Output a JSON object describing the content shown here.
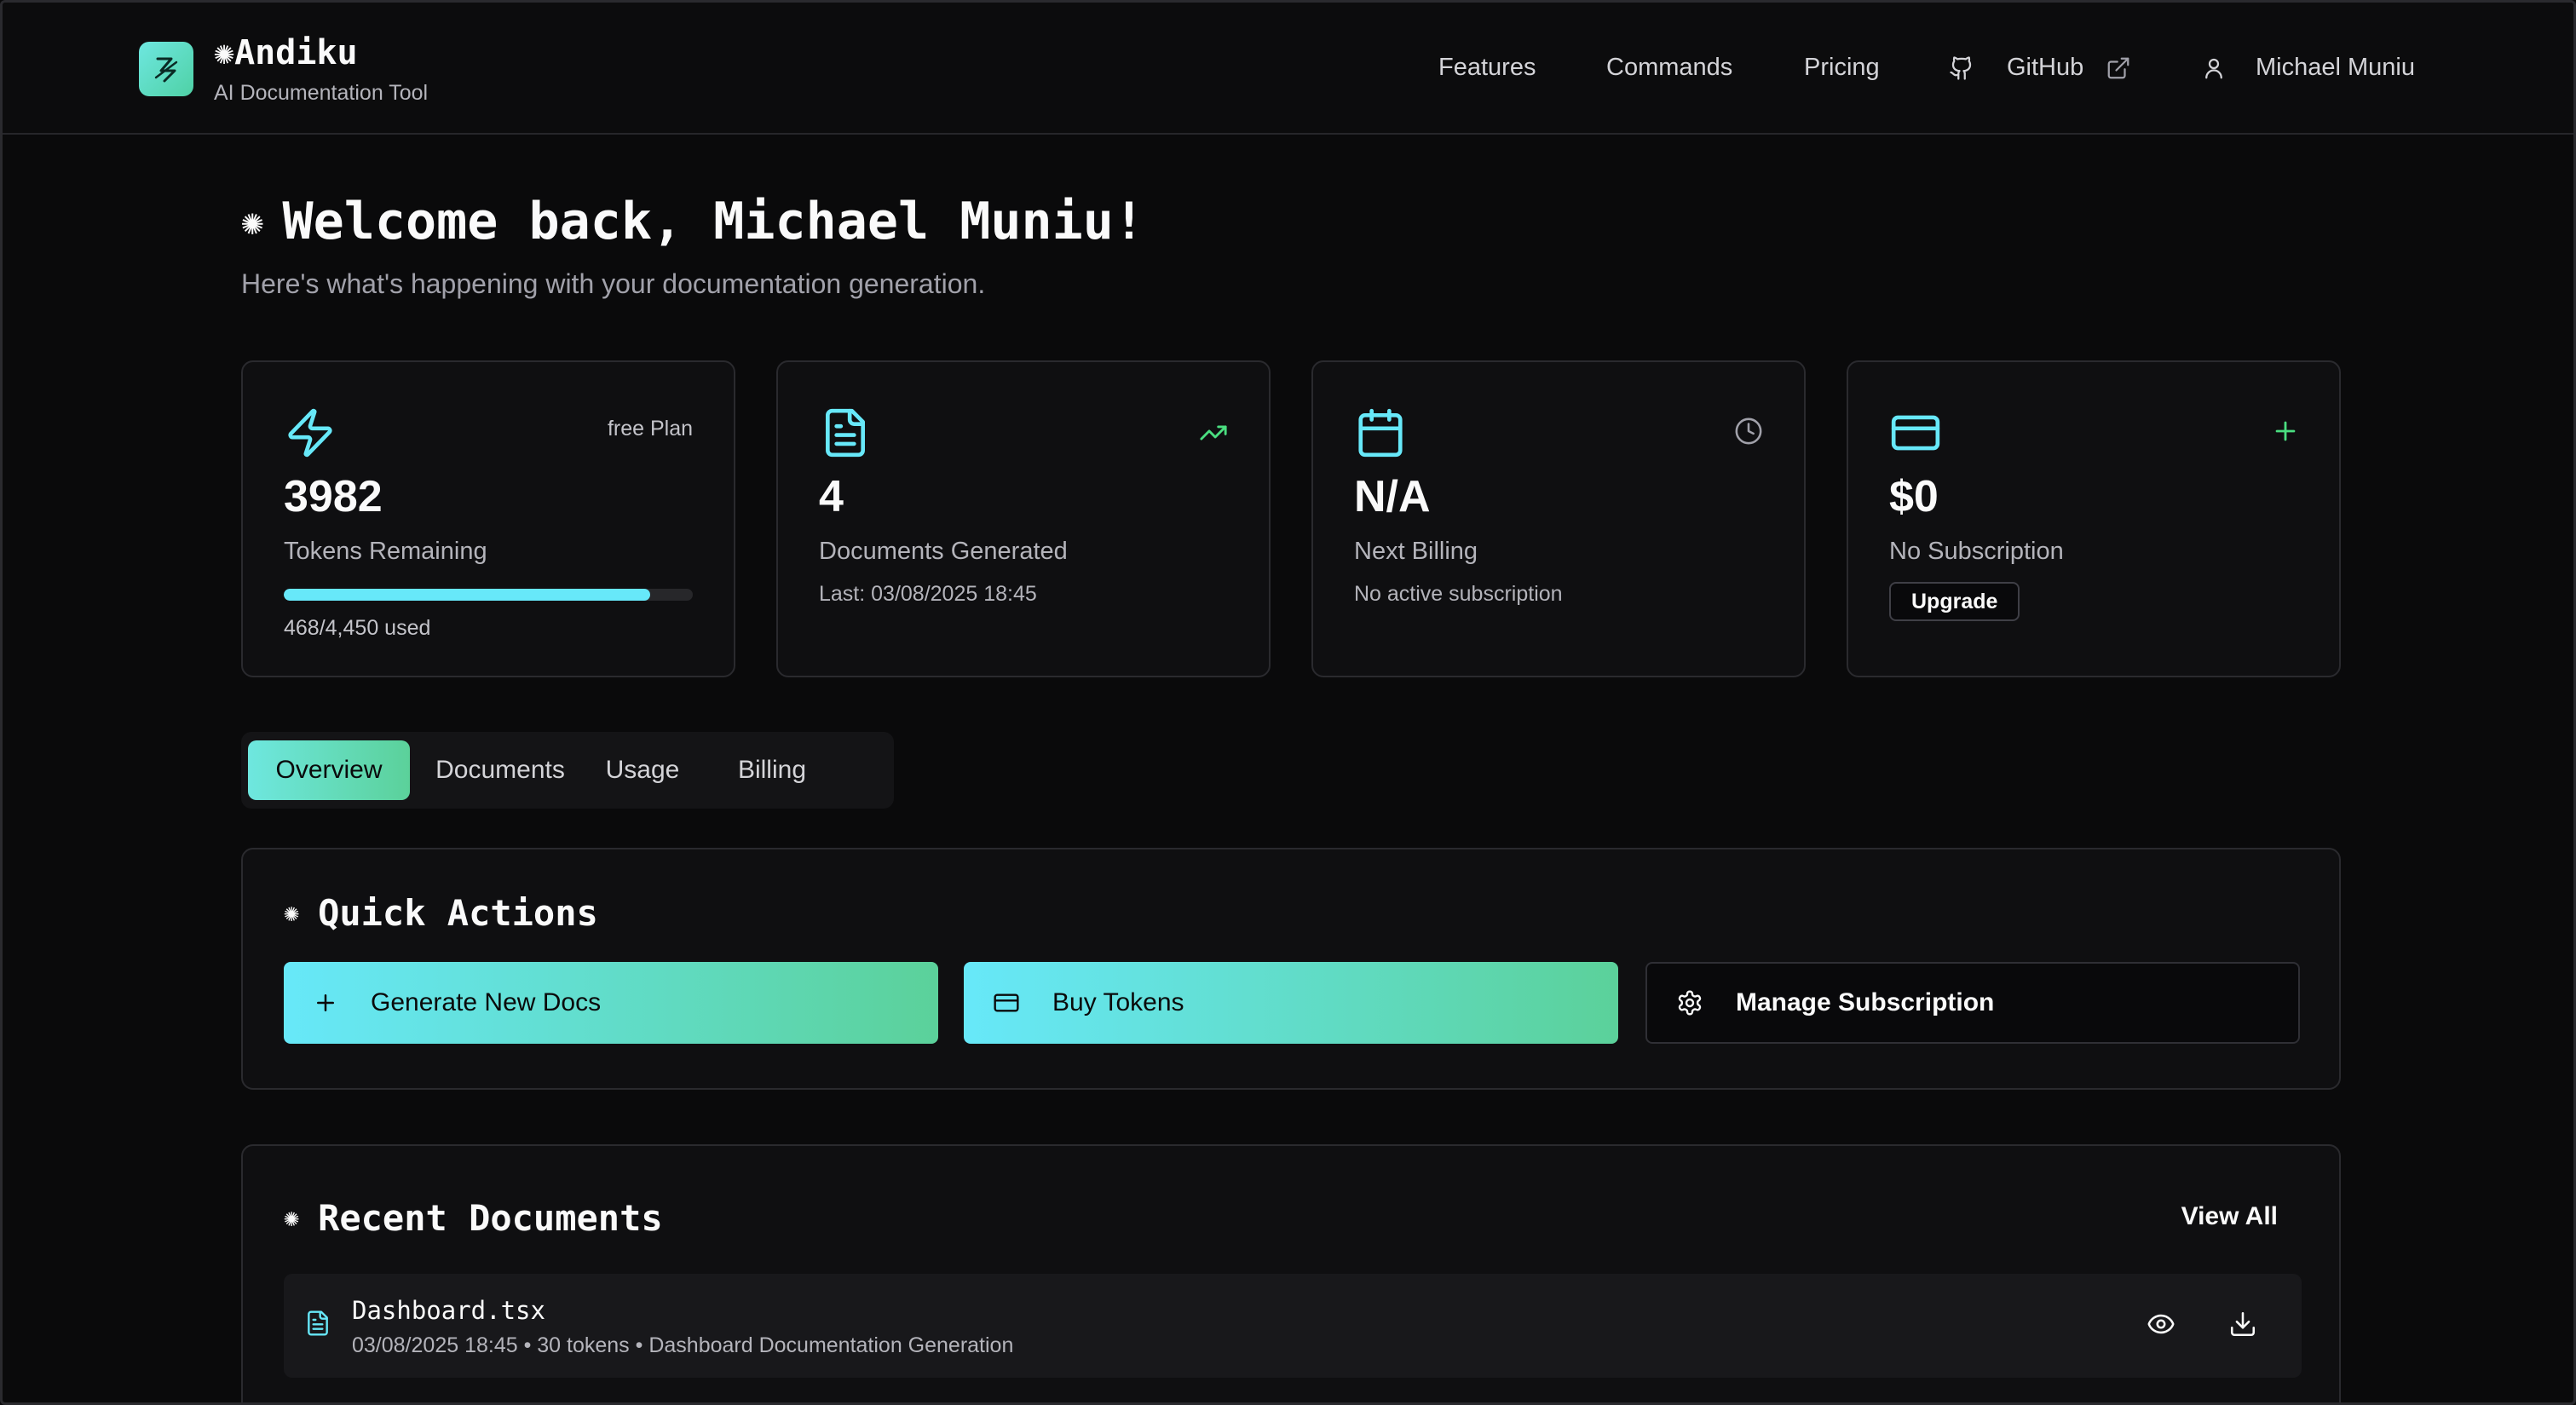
{
  "header": {
    "brand_name": "Andiku",
    "brand_tagline": "AI Documentation Tool",
    "nav": {
      "features": "Features",
      "commands": "Commands",
      "pricing": "Pricing",
      "github": "GitHub",
      "user_name": "Michael Muniu"
    }
  },
  "welcome": {
    "title": "Welcome back, Michael Muniu!",
    "subtitle": "Here's what's happening with your documentation generation."
  },
  "stats": {
    "tokens": {
      "plan": "free Plan",
      "value": "3982",
      "label": "Tokens Remaining",
      "progress_fraction": 0.895,
      "usage_text": "468/4,450 used"
    },
    "documents": {
      "value": "4",
      "label": "Documents Generated",
      "detail": "Last: 03/08/2025 18:45"
    },
    "billing": {
      "value": "N/A",
      "label": "Next Billing",
      "detail": "No active subscription"
    },
    "subscription": {
      "value": "$0",
      "label": "No Subscription",
      "upgrade_label": "Upgrade"
    }
  },
  "tabs": [
    {
      "label": "Overview",
      "active": true
    },
    {
      "label": "Documents",
      "active": false
    },
    {
      "label": "Usage",
      "active": false
    },
    {
      "label": "Billing",
      "active": false
    }
  ],
  "quick_actions": {
    "title": "Quick Actions",
    "generate_label": "Generate New Docs",
    "buy_tokens_label": "Buy Tokens",
    "manage_label": "Manage Subscription"
  },
  "recent_documents": {
    "title": "Recent Documents",
    "view_all_label": "View All",
    "items": [
      {
        "name": "Dashboard.tsx",
        "meta": "03/08/2025 18:45 • 30 tokens • Dashboard Documentation Generation"
      }
    ]
  },
  "colors": {
    "accent_cyan": "#67e8f9",
    "accent_green": "#5bd19a",
    "background": "#0a0a0b",
    "card_border": "#2a2a2e",
    "trend_green": "#4ade80"
  },
  "icons": [
    "logo-mark-icon",
    "sparkle-icon",
    "github-icon",
    "external-link-icon",
    "user-icon",
    "lightning-icon",
    "file-text-icon",
    "trending-up-icon",
    "calendar-icon",
    "clock-icon",
    "credit-card-icon",
    "plus-icon",
    "gear-icon",
    "eye-icon",
    "download-icon"
  ]
}
